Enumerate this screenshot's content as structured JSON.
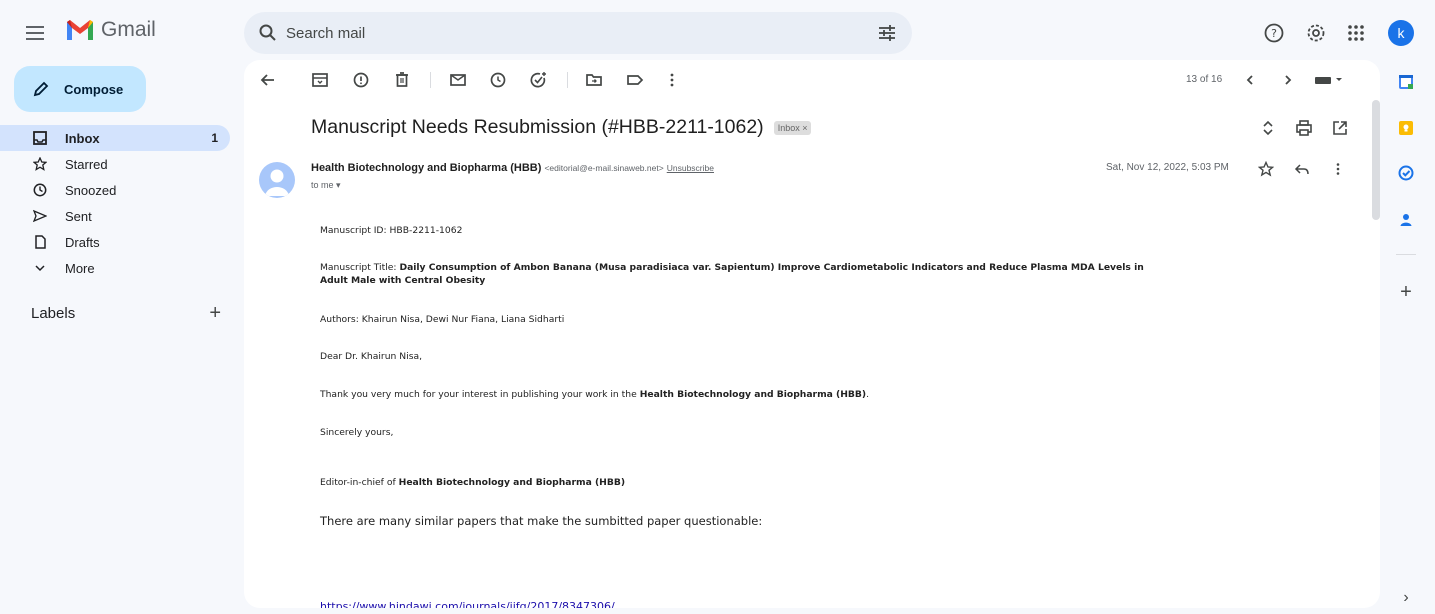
{
  "app": {
    "brand": "Gmail",
    "avatar_letter": "k"
  },
  "search": {
    "placeholder": "Search mail"
  },
  "compose": {
    "label": "Compose"
  },
  "nav": {
    "items": [
      {
        "label": "Inbox",
        "count": "1"
      },
      {
        "label": "Starred"
      },
      {
        "label": "Snoozed"
      },
      {
        "label": "Sent"
      },
      {
        "label": "Drafts"
      },
      {
        "label": "More"
      }
    ]
  },
  "labels": {
    "heading": "Labels"
  },
  "pager": {
    "text": "13 of 16"
  },
  "email": {
    "subject": "Manuscript Needs Resubmission (#HBB-2211-1062)",
    "chip": "Inbox ×",
    "sender_name": "Health Biotechnology and Biopharma (HBB)",
    "sender_email": "<editorial@e-mail.sinaweb.net>",
    "unsubscribe": "Unsubscribe",
    "to": "to me",
    "date": "Sat, Nov 12, 2022, 5:03 PM",
    "body": {
      "id_line": "Manuscript ID: HBB-2211-1062",
      "title_prefix": "Manuscript Title: ",
      "title_bold_1": "Daily Consumption of Ambon Banana (Musa paradisiaca var. Sapientum) Improve Cardiometabolic Indicators and Reduce Plasma MDA Levels in",
      "title_bold_2": "Adult Male with Central Obesity",
      "authors": "Authors: Khairun Nisa, Dewi Nur Fiana, Liana Sidharti",
      "greeting": "Dear Dr. Khairun Nisa,",
      "thanks_prefix": "Thank you very much for your interest in publishing your work in the ",
      "thanks_bold": "Health Biotechnology and Biopharma (HBB)",
      "thanks_suffix": ".",
      "closing": "Sincerely yours,",
      "editor_prefix": "Editor-in-chief of ",
      "editor_bold": "Health Biotechnology and Biopharma (HBB)",
      "note": "There are many similar papers that make the sumbitted paper questionable:",
      "link": "https://www.hindawi.com/journals/ijfq/2017/8347306/"
    }
  },
  "colors": {
    "accent": "#1a73e8",
    "compose_bg": "#c2e7ff",
    "active_nav": "#d3e3fd",
    "page_bg": "#f6f8fc"
  }
}
